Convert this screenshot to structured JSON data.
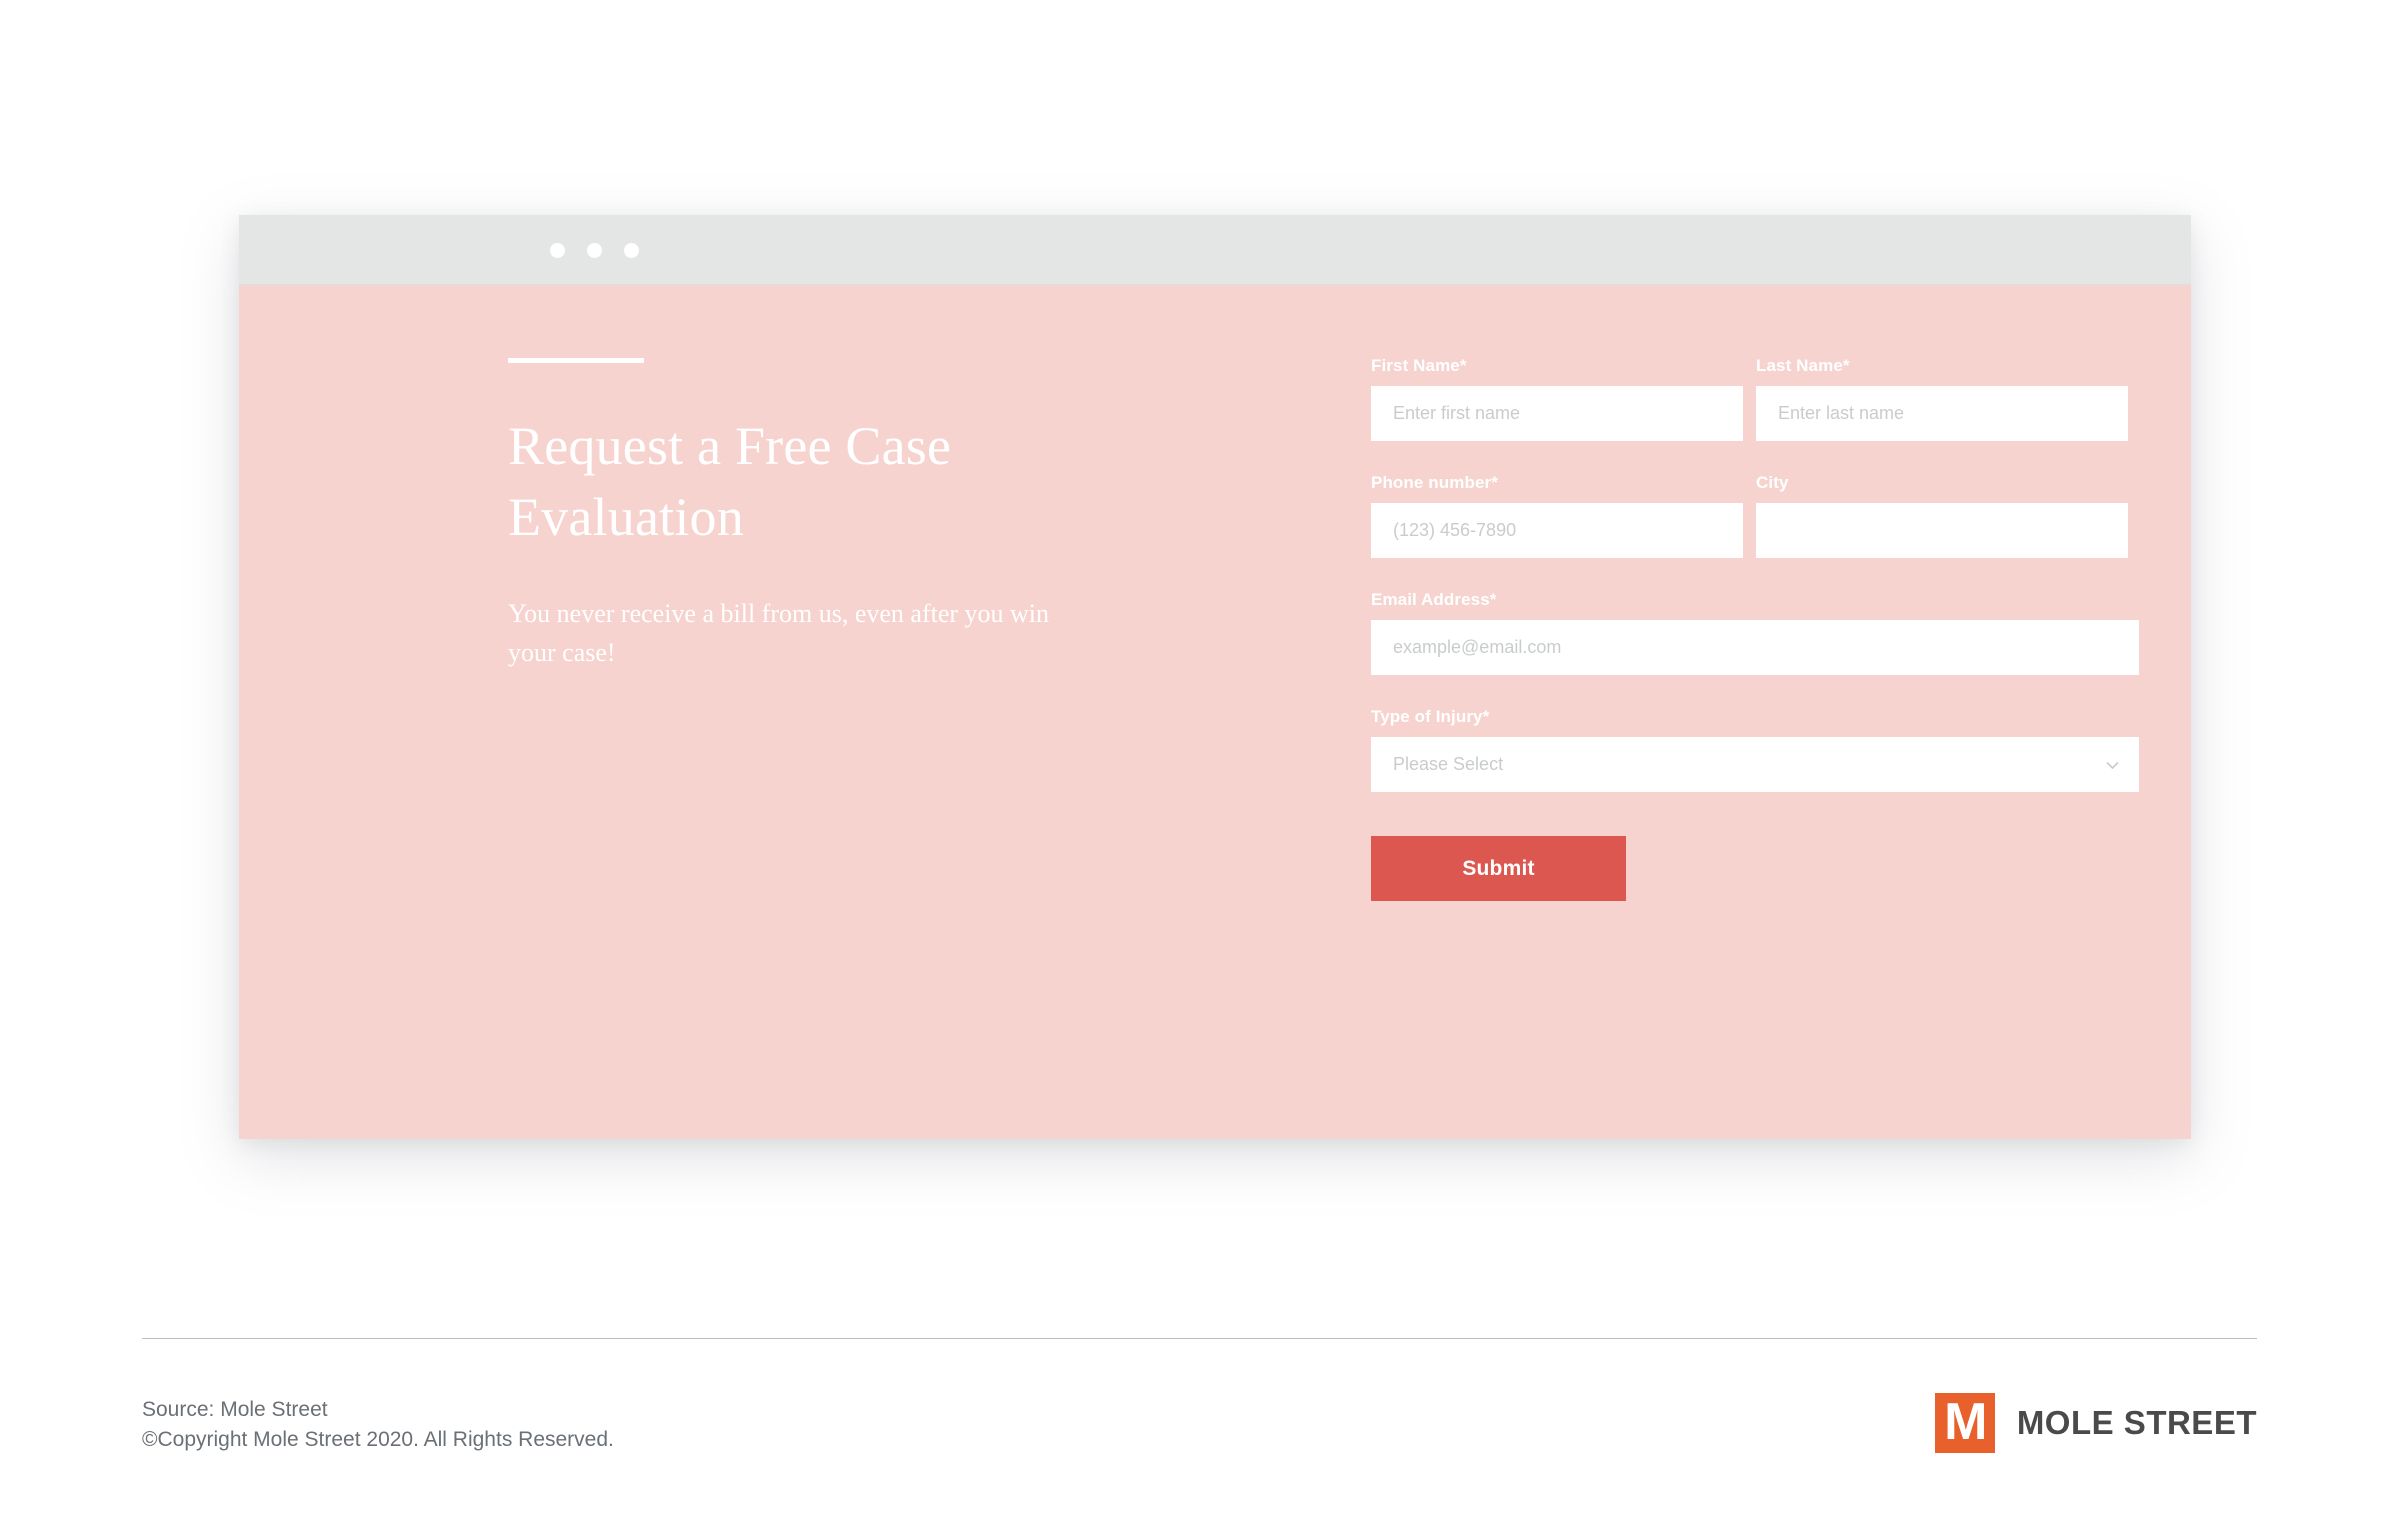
{
  "browser": {
    "dots": [
      "window-dot-1",
      "window-dot-2",
      "window-dot-3"
    ]
  },
  "hero": {
    "heading": "Request a Free Case Evaluation",
    "subtext": "You never receive a bill from us, even after you win your case!"
  },
  "form": {
    "fields": [
      {
        "label": "First Name*",
        "placeholder": "Enter first name",
        "value": "",
        "type": "text"
      },
      {
        "label": "Last Name*",
        "placeholder": "Enter last name",
        "value": "",
        "type": "text"
      },
      {
        "label": "Phone number*",
        "placeholder": "(123) 456-7890",
        "value": "",
        "type": "tel"
      },
      {
        "label": "City",
        "placeholder": "",
        "value": "",
        "type": "text"
      },
      {
        "label": "Email Address*",
        "placeholder": "example@email.com",
        "value": "",
        "type": "email"
      },
      {
        "label": "Type of Injury*",
        "placeholder": "Please Select",
        "value": "Please Select",
        "type": "select"
      }
    ],
    "submit_label": "Submit"
  },
  "footer": {
    "source_line": "Source: Mole Street",
    "copyright_line": "©Copyright Mole Street 2020. All Rights Reserved.",
    "logo_text": "MOLE STREET",
    "logo_mark_letter": "M"
  },
  "colors": {
    "pink_panel": "#f6d3cf",
    "submit_red": "#dc5750",
    "logo_orange": "#e8602c",
    "titlebar_gray": "#e4e6e6",
    "footer_text": "#6b7075",
    "logo_text": "#4a4a4a"
  }
}
